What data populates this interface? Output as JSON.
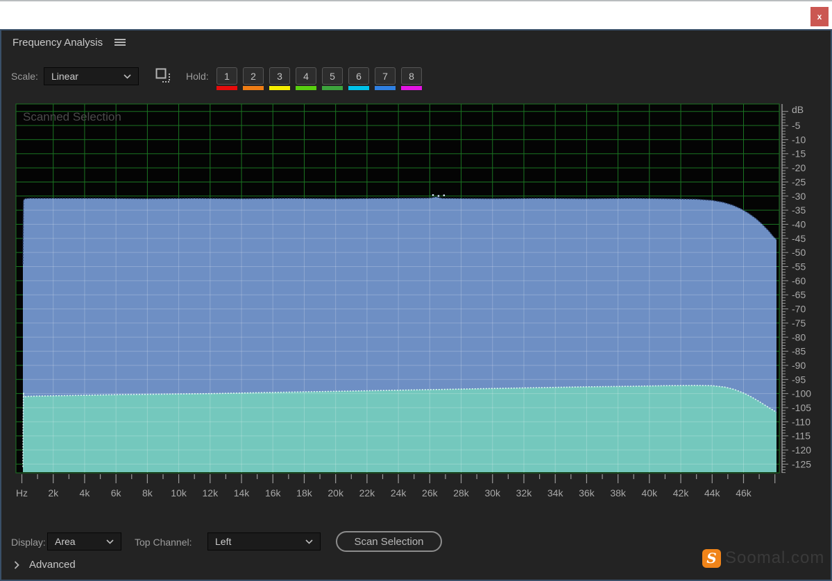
{
  "titlebar": {
    "close_label": "x"
  },
  "panel": {
    "title": "Frequency Analysis"
  },
  "scale": {
    "label": "Scale:",
    "value": "Linear"
  },
  "hold": {
    "label": "Hold:",
    "buttons": [
      {
        "label": "1",
        "color": "#e60b0b"
      },
      {
        "label": "2",
        "color": "#ef7d15"
      },
      {
        "label": "3",
        "color": "#f7ef00"
      },
      {
        "label": "4",
        "color": "#59cf10"
      },
      {
        "label": "5",
        "color": "#3da43d"
      },
      {
        "label": "6",
        "color": "#00c2ea"
      },
      {
        "label": "7",
        "color": "#2f80e2"
      },
      {
        "label": "8",
        "color": "#e414e4"
      }
    ]
  },
  "display": {
    "label": "Display:",
    "value": "Area"
  },
  "top_channel": {
    "label": "Top Channel:",
    "value": "Left"
  },
  "scan": {
    "label": "Scan Selection"
  },
  "advanced": {
    "label": "Advanced"
  },
  "soomal": {
    "logo_letter": "S",
    "text": "Soomal.com"
  },
  "chart_data": {
    "type": "area",
    "title": "Scanned Selection",
    "grid": true,
    "grid_color": "#1b7522",
    "x_axis": {
      "unit_label": "Hz",
      "range_khz": [
        0,
        48
      ],
      "tick_labels": [
        "Hz",
        "2k",
        "4k",
        "6k",
        "8k",
        "10k",
        "12k",
        "14k",
        "16k",
        "18k",
        "20k",
        "22k",
        "24k",
        "26k",
        "28k",
        "30k",
        "32k",
        "34k",
        "36k",
        "38k",
        "40k",
        "42k",
        "44k",
        "46k"
      ],
      "label_step_khz": 2,
      "minor_step_khz": 1
    },
    "y_axis": {
      "unit_label": "dB",
      "range_db": [
        -128,
        2
      ],
      "tick_labels": [
        "-5",
        "-10",
        "-15",
        "-20",
        "-25",
        "-30",
        "-35",
        "-40",
        "-45",
        "-50",
        "-55",
        "-60",
        "-65",
        "-70",
        "-75",
        "-80",
        "-85",
        "-90",
        "-95",
        "-100",
        "-105",
        "-110",
        "-115",
        "-120",
        "-125"
      ],
      "label_step_db": 5,
      "minor_step_db": 1
    },
    "series": [
      {
        "name": "top-channel-left",
        "fill": "#6e8fc4",
        "edge": "#24355c",
        "points_khz_db": [
          [
            0.066,
            -54
          ],
          [
            0.08,
            -44
          ],
          [
            0.1,
            -31.5
          ],
          [
            0.2,
            -30.9
          ],
          [
            0.5,
            -30.8
          ],
          [
            2,
            -30.8
          ],
          [
            5,
            -30.8
          ],
          [
            8,
            -30.9
          ],
          [
            11,
            -30.8
          ],
          [
            14,
            -30.9
          ],
          [
            17,
            -30.8
          ],
          [
            20,
            -30.9
          ],
          [
            23,
            -30.8
          ],
          [
            26,
            -30.7
          ],
          [
            26.4,
            -30.3
          ],
          [
            26.8,
            -30.8
          ],
          [
            30,
            -30.9
          ],
          [
            33,
            -30.8
          ],
          [
            36,
            -30.9
          ],
          [
            39,
            -30.8
          ],
          [
            41,
            -30.9
          ],
          [
            43,
            -31.1
          ],
          [
            44,
            -31.5
          ],
          [
            44.7,
            -32.2
          ],
          [
            45.3,
            -33.2
          ],
          [
            45.8,
            -34.4
          ],
          [
            46.3,
            -36
          ],
          [
            46.8,
            -38
          ],
          [
            47.2,
            -40
          ],
          [
            47.6,
            -42.3
          ],
          [
            47.9,
            -44.3
          ],
          [
            48.1,
            -45.4
          ]
        ]
      },
      {
        "name": "bottom-channel-right",
        "fill": "#74c8bd",
        "edge": "#dcf7f1",
        "points_khz_db": [
          [
            0.066,
            -126
          ],
          [
            0.08,
            -112
          ],
          [
            0.1,
            -99.6
          ],
          [
            0.14,
            -101.3
          ],
          [
            0.3,
            -101
          ],
          [
            1,
            -100.9
          ],
          [
            3,
            -100.7
          ],
          [
            6,
            -100.4
          ],
          [
            9,
            -100.2
          ],
          [
            12,
            -100
          ],
          [
            15,
            -99.7
          ],
          [
            18,
            -99.4
          ],
          [
            21,
            -99.1
          ],
          [
            24,
            -98.8
          ],
          [
            27,
            -98.5
          ],
          [
            30,
            -98.2
          ],
          [
            33,
            -97.9
          ],
          [
            36,
            -97.6
          ],
          [
            39,
            -97.4
          ],
          [
            41,
            -97.2
          ],
          [
            43,
            -97.1
          ],
          [
            44,
            -97.2
          ],
          [
            44.8,
            -97.7
          ],
          [
            45.4,
            -98.5
          ],
          [
            46,
            -99.8
          ],
          [
            46.5,
            -101.2
          ],
          [
            47,
            -102.8
          ],
          [
            47.4,
            -104.2
          ],
          [
            47.8,
            -105.6
          ],
          [
            48.1,
            -106.6
          ]
        ]
      }
    ],
    "noise_dots_khz_db": [
      [
        26.2,
        -29.6
      ],
      [
        26.55,
        -29.9
      ],
      [
        26.9,
        -29.7
      ]
    ]
  }
}
